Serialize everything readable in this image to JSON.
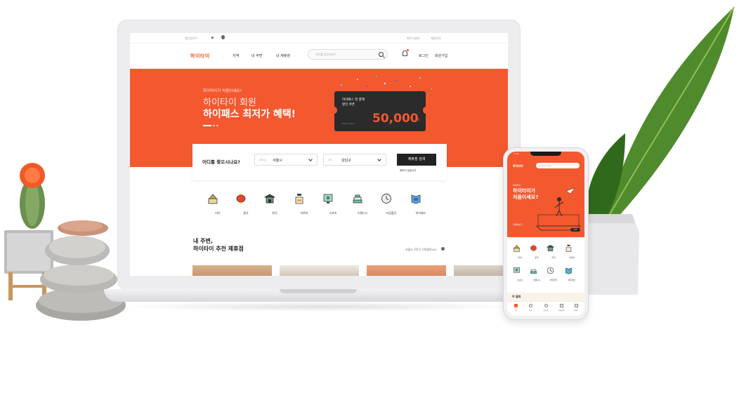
{
  "laptop": {
    "top_strip": {
      "left_text": "앱다운로드",
      "right_text_1": "파트너센터",
      "right_text_2": "제휴문의"
    },
    "nav": {
      "logo_text": "하이타이",
      "items": [
        "지역",
        "내 주변",
        "내 제휴점"
      ],
      "search_placeholder": "어디를 찾으세요?",
      "login": "로그인",
      "signup": "회원가입"
    },
    "hero": {
      "small": "하이타이가 처음이세요?",
      "line1": "하이타이 회원",
      "line2": "하이패스 최저가 혜택!",
      "ticket_line1": "하이패스 첫 결제",
      "ticket_line2": "할인 쿠폰",
      "ticket_small": "HiTAI Coupon",
      "ticket_amount": "50,000",
      "ticket_unit": "원"
    },
    "search_card": {
      "question": "어디를 찾으시나요?",
      "region_label": "광역시도",
      "region_value": "서울시",
      "district_label": "지역",
      "district_value": "강남구",
      "button": "제휴점 검색",
      "link": "원하지 않습니다"
    },
    "categories": [
      "타이",
      "중국",
      "한국",
      "아로마",
      "스포츠",
      "스웨디시",
      "타임할인",
      "하이패스"
    ],
    "section": {
      "title_line1": "내 주변,",
      "title_line2": "하이타이 추천 제휴점",
      "location_link": "서울시 구로구 디지털로242"
    }
  },
  "phone": {
    "status_time": "9:41",
    "logo_text": "하이타이",
    "search_placeholder": "어디를 찾으세요?",
    "hero_small": "하이타이",
    "hero_line1": "하이타이가",
    "hero_line2": "처음이세요?",
    "hero_more": "자세히보기",
    "hero_pager": "1/4",
    "categories": [
      "타이",
      "중국",
      "한국",
      "아로마",
      "스포츠",
      "스웨디시",
      "타임할인",
      "하이패스"
    ],
    "section_title": "이 달의",
    "tabs": [
      "홈",
      "지역",
      "내주변",
      "내제휴점",
      "내정보"
    ]
  },
  "colors": {
    "accent": "#f3582f",
    "dark": "#2b2b2b"
  }
}
